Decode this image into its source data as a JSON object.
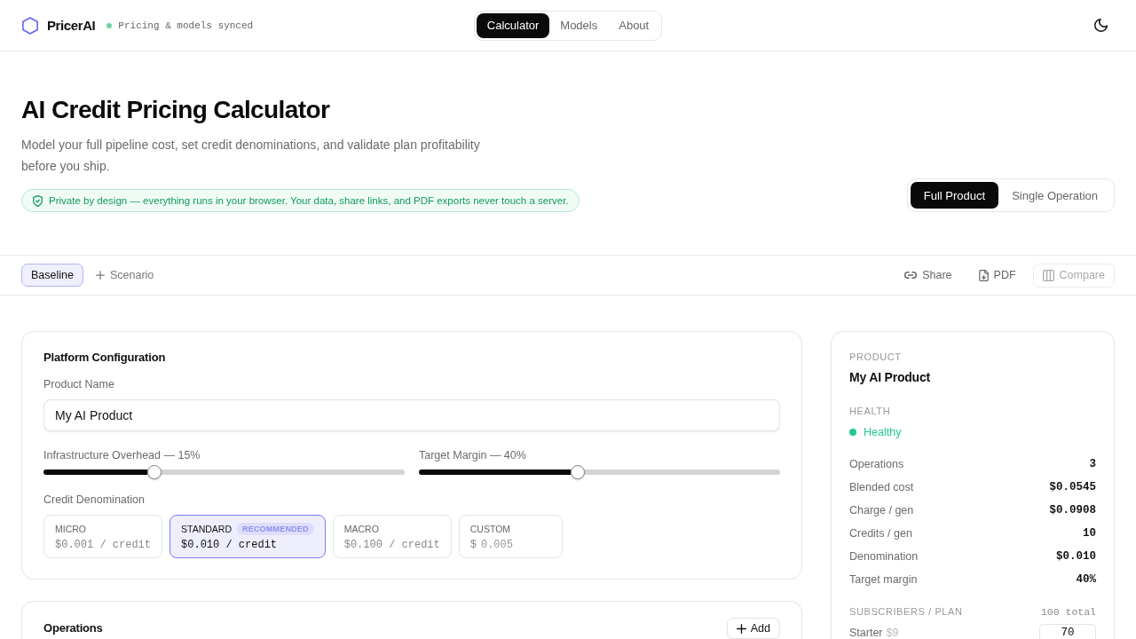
{
  "header": {
    "logo": "PricerAI",
    "sync_status": "Pricing & models synced",
    "nav": [
      {
        "label": "Calculator",
        "selected": true
      },
      {
        "label": "Models",
        "selected": false
      },
      {
        "label": "About",
        "selected": false
      }
    ]
  },
  "hero": {
    "title": "AI Credit Pricing Calculator",
    "subtitle": "Model your full pipeline cost, set credit denominations, and validate plan profitability before you ship.",
    "privacy_note": "Private by design — everything runs in your browser. Your data, share links, and PDF exports never touch a server.",
    "mode_tabs": [
      {
        "label": "Full Product",
        "selected": true
      },
      {
        "label": "Single Operation",
        "selected": false
      }
    ]
  },
  "scenario_bar": {
    "scenarios": [
      {
        "label": "Baseline",
        "selected": true
      }
    ],
    "add_scenario": "Scenario",
    "actions": [
      {
        "label": "Share",
        "disabled": false
      },
      {
        "label": "PDF",
        "disabled": false
      },
      {
        "label": "Compare",
        "disabled": true
      }
    ]
  },
  "platform_config": {
    "title": "Platform Configuration",
    "product_name_label": "Product Name",
    "product_name": "My AI Product",
    "sliders": [
      {
        "label": "Infrastructure Overhead — 15%",
        "level": 0.307
      },
      {
        "label": "Target Margin — 40%",
        "level": 0.44
      }
    ],
    "denomination_label": "Credit Denomination",
    "denominations": [
      {
        "kind": "preset",
        "name": "MICRO",
        "price": "$0.001 / credit",
        "selected": false
      },
      {
        "kind": "preset",
        "name": "STANDARD",
        "badge": "RECOMMENDED",
        "price": "$0.010 / credit",
        "selected": true
      },
      {
        "kind": "preset",
        "name": "MACRO",
        "price": "$0.100 / credit",
        "selected": false
      },
      {
        "kind": "custom",
        "name": "CUSTOM",
        "prefix": "$",
        "placeholder": "0.005",
        "selected": false
      }
    ]
  },
  "operations": {
    "title": "Operations",
    "add_button": "Add"
  },
  "summary": {
    "product_label": "PRODUCT",
    "product_name": "My AI Product",
    "health_label": "HEALTH",
    "health": {
      "status": "Healthy",
      "color": "#22c98a"
    },
    "metrics": [
      {
        "label": "Operations",
        "value": "3"
      },
      {
        "label": "Blended cost",
        "value": "$0.0545"
      },
      {
        "label": "Charge / gen",
        "value": "$0.0908"
      },
      {
        "label": "Credits / gen",
        "value": "10"
      },
      {
        "label": "Denomination",
        "value": "$0.010"
      },
      {
        "label": "Target margin",
        "value": "40%"
      }
    ],
    "subscribers_label": "SUBSCRIBERS / PLAN",
    "subscribers_total": "100 total",
    "plans": [
      {
        "name": "Starter",
        "price": "$9",
        "subscribers": "70"
      }
    ]
  }
}
